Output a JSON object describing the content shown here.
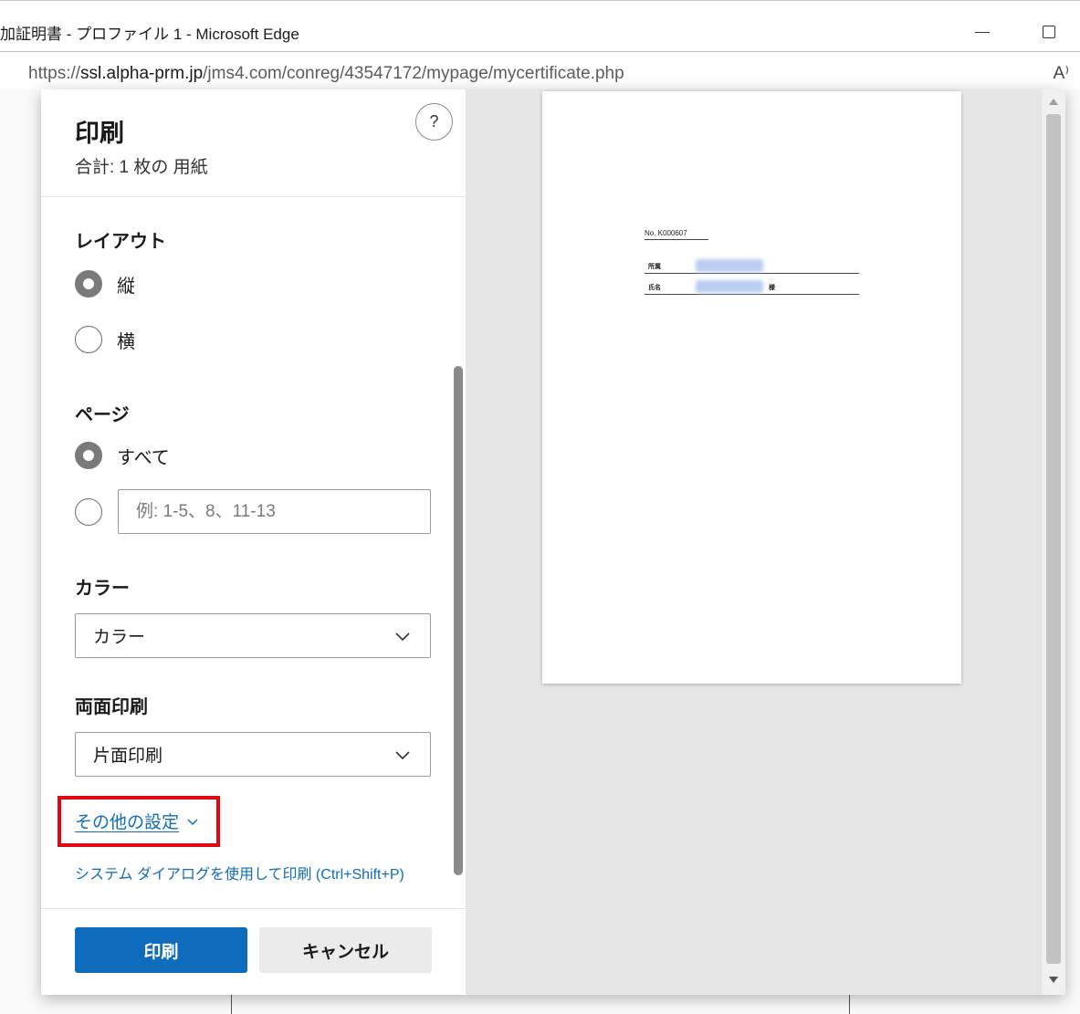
{
  "window": {
    "title": "加証明書 - プロファイル 1 - Microsoft Edge",
    "minimize_icon": "minimize-icon",
    "maximize_icon": "maximize-icon"
  },
  "address_bar": {
    "url_scheme": "https://",
    "url_host": "ssl.alpha-prm.jp",
    "url_path": "/jms4.com/conreg/43547172/mypage/mycertificate.php",
    "read_aloud_label": "A⁾",
    "read_aloud_icon": "read-aloud-icon"
  },
  "print_dialog": {
    "title": "印刷",
    "subtitle": "合計: 1 枚の 用紙",
    "help_label": "?",
    "layout": {
      "label": "レイアウト",
      "options": [
        {
          "label": "縦",
          "checked": true
        },
        {
          "label": "横",
          "checked": false
        }
      ]
    },
    "pages": {
      "label": "ページ",
      "all_label": "すべて",
      "all_checked": true,
      "range_value": "",
      "range_placeholder": "例: 1-5、8、11-13"
    },
    "color": {
      "label": "カラー",
      "selected": "カラー"
    },
    "duplex": {
      "label": "両面印刷",
      "selected": "片面印刷"
    },
    "more_settings_label": "その他の設定",
    "highlight_color": "#e30613",
    "system_dialog_label": "システム ダイアログを使用して印刷 (Ctrl+Shift+P)",
    "print_button": "印刷",
    "cancel_button": "キャンセル",
    "accent_color": "#0f6cbd"
  },
  "preview": {
    "cert_no": "No.  K000607",
    "rows": [
      {
        "label": "所属",
        "suffix": ""
      },
      {
        "label": "氏名",
        "suffix": "様"
      }
    ]
  }
}
